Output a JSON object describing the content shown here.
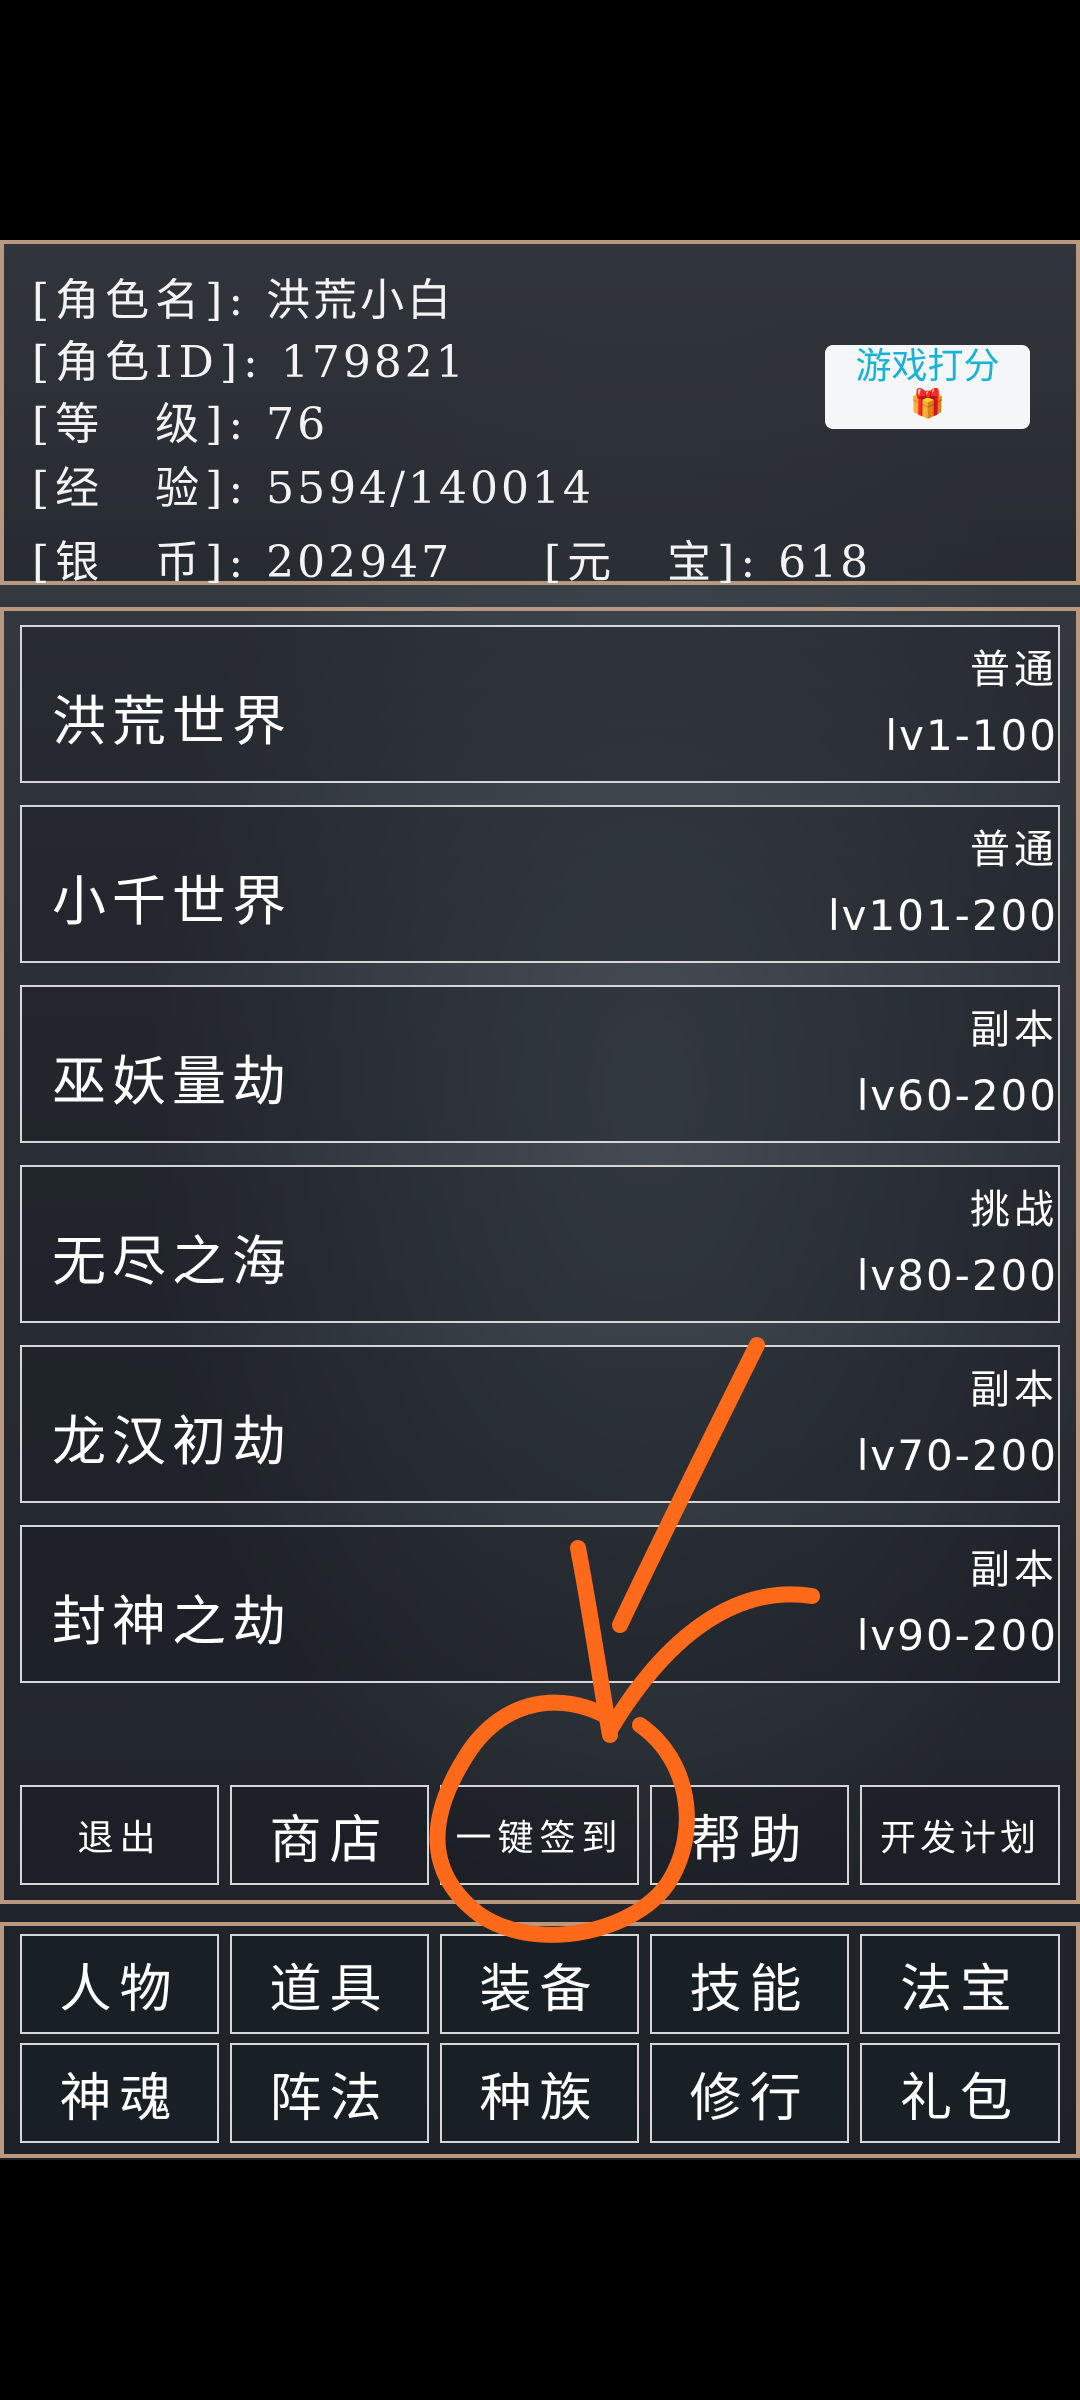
{
  "profile": {
    "name_label": "[角色名]:",
    "name_value": "洪荒小白",
    "id_label": "[角色ID]:",
    "id_value": "179821",
    "level_label": "[等　级]:",
    "level_value": "76",
    "exp_label": "[经　验]:",
    "exp_value": "5594/140014",
    "silver_label": "[银　币]:",
    "silver_value": "202947",
    "ingot_label": "[元　宝]:",
    "ingot_value": "618"
  },
  "rating_button": {
    "label": "游戏打分",
    "icon": "gift-icon"
  },
  "worlds": [
    {
      "name": "洪荒世界",
      "kind": "普通",
      "range": "lv1-100"
    },
    {
      "name": "小千世界",
      "kind": "普通",
      "range": "lv101-200"
    },
    {
      "name": "巫妖量劫",
      "kind": "副本",
      "range": "lv60-200"
    },
    {
      "name": "无尽之海",
      "kind": "挑战",
      "range": "lv80-200"
    },
    {
      "name": "龙汉初劫",
      "kind": "副本",
      "range": "lv70-200"
    },
    {
      "name": "封神之劫",
      "kind": "副本",
      "range": "lv90-200"
    }
  ],
  "actions": [
    "退出",
    "商店",
    "一键签到",
    "帮助",
    "开发计划"
  ],
  "nav": {
    "row1": [
      "人物",
      "道具",
      "装备",
      "技能",
      "法宝"
    ],
    "row2": [
      "神魂",
      "阵法",
      "种族",
      "修行",
      "礼包"
    ]
  },
  "annotation": {
    "color": "#ff6a1a"
  }
}
